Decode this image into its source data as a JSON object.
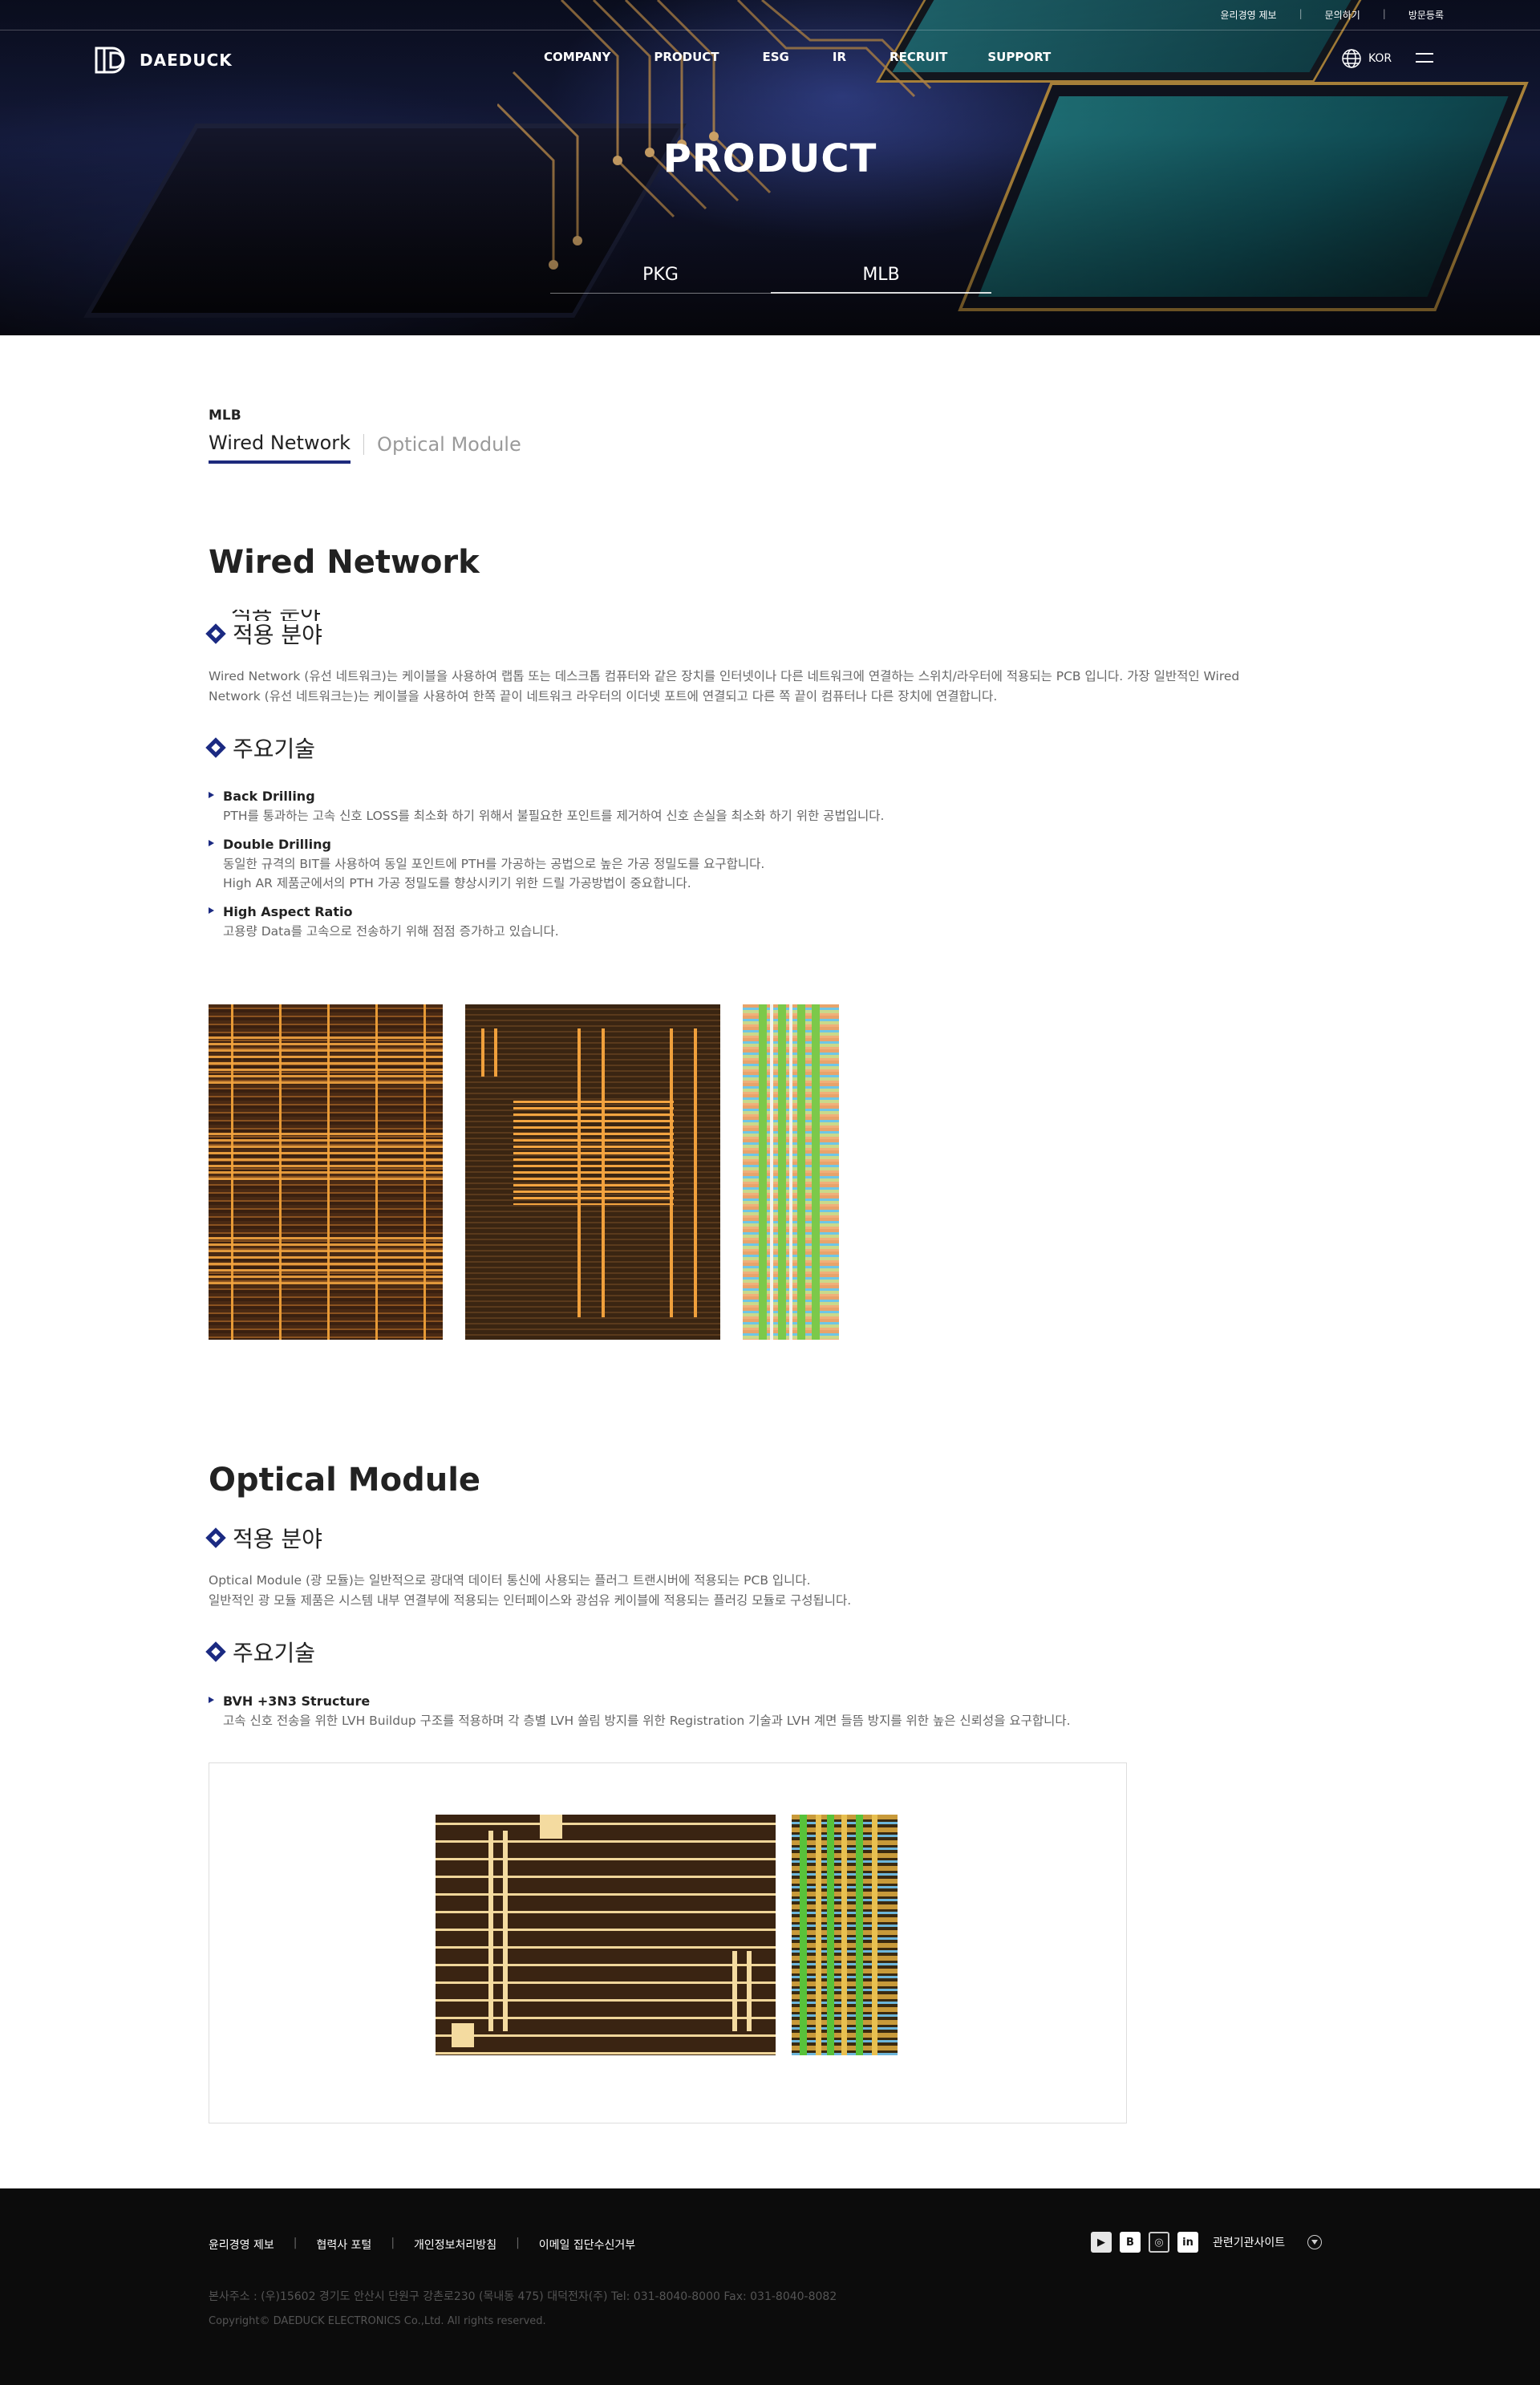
{
  "header": {
    "util_links": [
      "윤리경영 제보",
      "문의하기",
      "방문등록"
    ],
    "logo_text": "DAEDUCK",
    "gnb": [
      "COMPANY",
      "PRODUCT",
      "ESG",
      "IR",
      "RECRUIT",
      "SUPPORT"
    ],
    "lang": "KOR"
  },
  "hero": {
    "title": "PRODUCT",
    "tabs": [
      "PKG",
      "MLB"
    ],
    "active_tab": "MLB"
  },
  "page": {
    "breadcrumb": "MLB",
    "tabs": [
      "Wired Network",
      "Optical Module"
    ],
    "active_tab": "Wired Network"
  },
  "wired": {
    "title": "Wired Network",
    "ghost_heading": "적용 분야",
    "application_heading": "적용 분야",
    "application_text": [
      "Wired Network (유선 네트워크)는 케이블을 사용하여 랩톱 또는 데스크톱 컴퓨터와 같은 장치를 인터넷이나 다른 네트워크에 연결하는 스위치/라우터에 적용되는 PCB 입니다. 가장 일반적인 Wired",
      "Network (유선 네트워크는)는 케이블을 사용하여 한쪽 끝이 네트워크 라우터의 이더넷 포트에 연결되고 다른 쪽 끝이 컴퓨터나 다른 장치에 연결합니다."
    ],
    "tech_heading": "주요기술",
    "tech": [
      {
        "name": "Back Drilling",
        "desc": [
          "PTH를 통과하는 고속 신호 LOSS를 최소화 하기 위해서 불필요한 포인트를 제거하여 신호 손실을 최소화 하기 위한 공법입니다."
        ]
      },
      {
        "name": "Double Drilling",
        "desc": [
          "동일한 규격의 BIT를 사용하여 동일 포인트에 PTH를 가공하는 공법으로 높은 가공 정밀도를 요구합니다.",
          "High AR 제품군에서의 PTH 가공 정밀도를 향상시키기 위한 드릴 가공방법이 중요합니다."
        ]
      },
      {
        "name": "High Aspect Ratio",
        "desc": [
          "고용량 Data를 고속으로 전송하기 위해 점점 증가하고 있습니다."
        ]
      }
    ]
  },
  "optical": {
    "title": "Optical Module",
    "application_heading": "적용 분야",
    "application_text": [
      "Optical Module (광 모듈)는 일반적으로 광대역 데이터 통신에 사용되는 플러그 트랜시버에 적용되는 PCB 입니다.",
      "일반적인 광 모듈 제품은 시스템 내부 연결부에 적용되는 인터페이스와 광섬유 케이블에 적용되는 플러깅 모듈로 구성됩니다."
    ],
    "tech_heading": "주요기술",
    "tech": [
      {
        "name": "BVH +3N3 Structure",
        "desc": [
          "고속 신호 전송을 위한 LVH Buildup 구조를 적용하며 각 층별 LVH 쏠림 방지를 위한 Registration 기술과 LVH 계면 들뜸 방지를 위한 높은 신뢰성을 요구합니다."
        ]
      }
    ]
  },
  "footer": {
    "links": [
      "윤리경영 제보",
      "협력사 포털",
      "개인정보처리방침",
      "이메일 집단수신거부"
    ],
    "social": [
      "youtube-icon",
      "blog-icon",
      "instagram-icon",
      "linkedin-icon"
    ],
    "related_label": "관련기관사이트",
    "address": "본사주소 : (우)15602 경기도 안산시 단원구 강촌로230 (목내동 475) 대덕전자(주)   Tel: 031-8040-8000   Fax: 031-8040-8082",
    "copyright": "Copyright© DAEDUCK ELECTRONICS Co.,Ltd. All rights reserved."
  },
  "colors": {
    "accent": "#1b2a82",
    "footer_bg": "#0c0c0c"
  }
}
